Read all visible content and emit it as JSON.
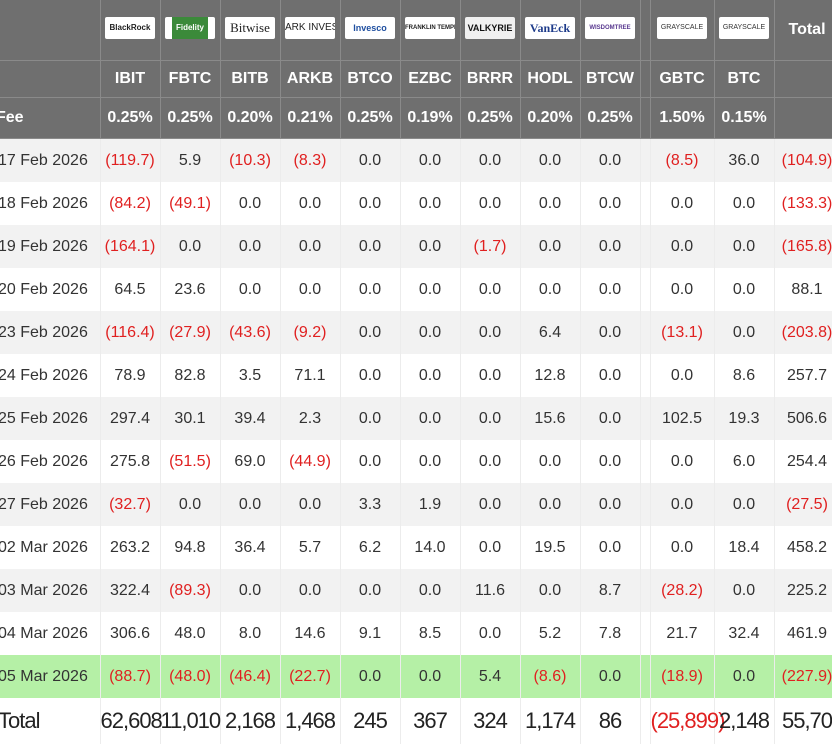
{
  "header": {
    "issuers": [
      {
        "name": "BlackRock"
      },
      {
        "name": "Fidelity"
      },
      {
        "name": "Bitwise"
      },
      {
        "name": "ARK INVEST"
      },
      {
        "name": "Invesco"
      },
      {
        "name": "FRANKLIN TEMPLETON"
      },
      {
        "name": "VALKYRIE"
      },
      {
        "name": "VanEck"
      },
      {
        "name": "WISDOMTREE"
      },
      {
        "name": "GRAYSCALE"
      },
      {
        "name": "GRAYSCALE"
      }
    ],
    "total_label": "Total",
    "tickers": [
      "IBIT",
      "FBTC",
      "BITB",
      "ARKB",
      "BTCO",
      "EZBC",
      "BRRR",
      "HODL",
      "BTCW",
      "GBTC",
      "BTC"
    ],
    "fee_label": "Fee",
    "fees": [
      "0.25%",
      "0.25%",
      "0.20%",
      "0.21%",
      "0.25%",
      "0.19%",
      "0.25%",
      "0.20%",
      "0.25%",
      "1.50%",
      "0.15%"
    ]
  },
  "rows": [
    {
      "date": "17 Feb 2026",
      "values": [
        "(119.7)",
        "5.9",
        "(10.3)",
        "(8.3)",
        "0.0",
        "0.0",
        "0.0",
        "0.0",
        "0.0",
        "(8.5)",
        "36.0"
      ],
      "total": "(104.9)"
    },
    {
      "date": "18 Feb 2026",
      "values": [
        "(84.2)",
        "(49.1)",
        "0.0",
        "0.0",
        "0.0",
        "0.0",
        "0.0",
        "0.0",
        "0.0",
        "0.0",
        "0.0"
      ],
      "total": "(133.3)"
    },
    {
      "date": "19 Feb 2026",
      "values": [
        "(164.1)",
        "0.0",
        "0.0",
        "0.0",
        "0.0",
        "0.0",
        "(1.7)",
        "0.0",
        "0.0",
        "0.0",
        "0.0"
      ],
      "total": "(165.8)"
    },
    {
      "date": "20 Feb 2026",
      "values": [
        "64.5",
        "23.6",
        "0.0",
        "0.0",
        "0.0",
        "0.0",
        "0.0",
        "0.0",
        "0.0",
        "0.0",
        "0.0"
      ],
      "total": "88.1"
    },
    {
      "date": "23 Feb 2026",
      "values": [
        "(116.4)",
        "(27.9)",
        "(43.6)",
        "(9.2)",
        "0.0",
        "0.0",
        "0.0",
        "6.4",
        "0.0",
        "(13.1)",
        "0.0"
      ],
      "total": "(203.8)"
    },
    {
      "date": "24 Feb 2026",
      "values": [
        "78.9",
        "82.8",
        "3.5",
        "71.1",
        "0.0",
        "0.0",
        "0.0",
        "12.8",
        "0.0",
        "0.0",
        "8.6"
      ],
      "total": "257.7"
    },
    {
      "date": "25 Feb 2026",
      "values": [
        "297.4",
        "30.1",
        "39.4",
        "2.3",
        "0.0",
        "0.0",
        "0.0",
        "15.6",
        "0.0",
        "102.5",
        "19.3"
      ],
      "total": "506.6"
    },
    {
      "date": "26 Feb 2026",
      "values": [
        "275.8",
        "(51.5)",
        "69.0",
        "(44.9)",
        "0.0",
        "0.0",
        "0.0",
        "0.0",
        "0.0",
        "0.0",
        "6.0"
      ],
      "total": "254.4"
    },
    {
      "date": "27 Feb 2026",
      "values": [
        "(32.7)",
        "0.0",
        "0.0",
        "0.0",
        "3.3",
        "1.9",
        "0.0",
        "0.0",
        "0.0",
        "0.0",
        "0.0"
      ],
      "total": "(27.5)"
    },
    {
      "date": "02 Mar 2026",
      "values": [
        "263.2",
        "94.8",
        "36.4",
        "5.7",
        "6.2",
        "14.0",
        "0.0",
        "19.5",
        "0.0",
        "0.0",
        "18.4"
      ],
      "total": "458.2"
    },
    {
      "date": "03 Mar 2026",
      "values": [
        "322.4",
        "(89.3)",
        "0.0",
        "0.0",
        "0.0",
        "0.0",
        "11.6",
        "0.0",
        "8.7",
        "(28.2)",
        "0.0"
      ],
      "total": "225.2"
    },
    {
      "date": "04 Mar 2026",
      "values": [
        "306.6",
        "48.0",
        "8.0",
        "14.6",
        "9.1",
        "8.5",
        "0.0",
        "5.2",
        "7.8",
        "21.7",
        "32.4"
      ],
      "total": "461.9"
    },
    {
      "date": "05 Mar 2026",
      "values": [
        "(88.7)",
        "(48.0)",
        "(46.4)",
        "(22.7)",
        "0.0",
        "0.0",
        "5.4",
        "(8.6)",
        "0.0",
        "(18.9)",
        "0.0"
      ],
      "total": "(227.9)",
      "highlight": true
    }
  ],
  "totals": {
    "label": "Total",
    "values": [
      "62,608",
      "11,010",
      "2,168",
      "1,468",
      "245",
      "367",
      "324",
      "1,174",
      "86",
      "(25,899)",
      "2,148"
    ],
    "total": "55,70"
  },
  "colors": {
    "header_bg": "#6f6f6f",
    "negative": "#e02020",
    "highlight": "#b5f0a6",
    "stripe": "#f2f2f2"
  }
}
